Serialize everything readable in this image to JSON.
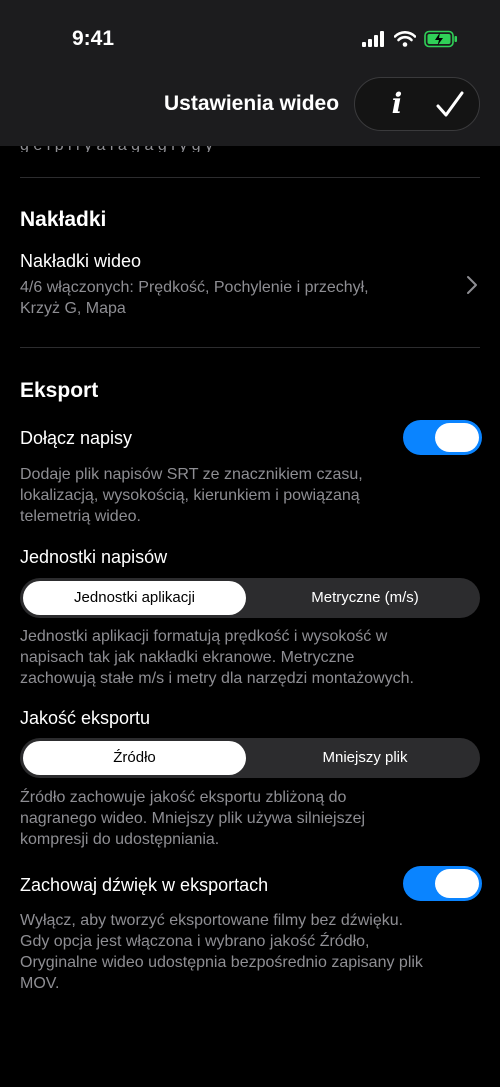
{
  "status_bar": {
    "time": "9:41"
  },
  "nav": {
    "title": "Ustawienia wideo",
    "info_label": "i"
  },
  "overlays": {
    "title": "Nakładki",
    "video_overlays_label": "Nakładki wideo",
    "video_overlays_value_line1": "4/6 włączonych: Prędkość, Pochylenie i przechył,",
    "video_overlays_value_line2": "Krzyż G, Mapa"
  },
  "export": {
    "title": "Eksport",
    "subtitles_toggle": {
      "label": "Dołącz napisy",
      "on": true,
      "description": [
        "Dodaje plik napisów SRT ze znacznikiem czasu,",
        "lokalizacją, wysokością, kierunkiem i powiązaną",
        "telemetrią wideo."
      ]
    },
    "subtitle_units": {
      "label": "Jednostki napisów",
      "options": [
        "Jednostki aplikacji",
        "Metryczne (m/s)"
      ],
      "selected": "Jednostki aplikacji",
      "description": [
        "Jednostki aplikacji formatują prędkość i wysokość w",
        "napisach tak jak nakładki ekranowe. Metryczne",
        "zachowują stałe m/s i metry dla narzędzi montażowych."
      ]
    },
    "quality": {
      "label": "Jakość eksportu",
      "options": [
        "Źródło",
        "Mniejszy plik"
      ],
      "selected": "Źródło",
      "description": [
        "Źródło zachowuje jakość eksportu zbliżoną do",
        "nagranego wideo. Mniejszy plik używa silniejszej",
        "kompresji do udostępniania."
      ]
    },
    "audio_toggle": {
      "label": "Zachowaj dźwięk w eksportach",
      "on": true,
      "description": [
        "Wyłącz, aby tworzyć eksportowane filmy bez dźwięku.",
        "Gdy opcja jest włączona i wybrano jakość Źródło,",
        "Oryginalne wideo udostępnia bezpośrednio zapisany plik",
        "MOV."
      ]
    }
  },
  "colors": {
    "accent": "#0a84ff",
    "background": "#000000",
    "secondary_text": "#8e8e93"
  }
}
